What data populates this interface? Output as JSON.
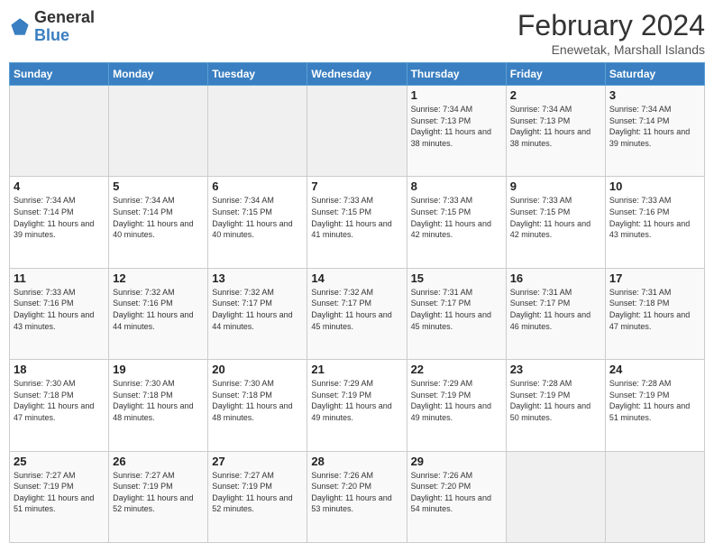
{
  "header": {
    "logo_general": "General",
    "logo_blue": "Blue",
    "month_title": "February 2024",
    "location": "Enewetak, Marshall Islands"
  },
  "days_of_week": [
    "Sunday",
    "Monday",
    "Tuesday",
    "Wednesday",
    "Thursday",
    "Friday",
    "Saturday"
  ],
  "weeks": [
    [
      {
        "day": "",
        "info": ""
      },
      {
        "day": "",
        "info": ""
      },
      {
        "day": "",
        "info": ""
      },
      {
        "day": "",
        "info": ""
      },
      {
        "day": "1",
        "info": "Sunrise: 7:34 AM\nSunset: 7:13 PM\nDaylight: 11 hours\nand 38 minutes."
      },
      {
        "day": "2",
        "info": "Sunrise: 7:34 AM\nSunset: 7:13 PM\nDaylight: 11 hours\nand 38 minutes."
      },
      {
        "day": "3",
        "info": "Sunrise: 7:34 AM\nSunset: 7:14 PM\nDaylight: 11 hours\nand 39 minutes."
      }
    ],
    [
      {
        "day": "4",
        "info": "Sunrise: 7:34 AM\nSunset: 7:14 PM\nDaylight: 11 hours\nand 39 minutes."
      },
      {
        "day": "5",
        "info": "Sunrise: 7:34 AM\nSunset: 7:14 PM\nDaylight: 11 hours\nand 40 minutes."
      },
      {
        "day": "6",
        "info": "Sunrise: 7:34 AM\nSunset: 7:15 PM\nDaylight: 11 hours\nand 40 minutes."
      },
      {
        "day": "7",
        "info": "Sunrise: 7:33 AM\nSunset: 7:15 PM\nDaylight: 11 hours\nand 41 minutes."
      },
      {
        "day": "8",
        "info": "Sunrise: 7:33 AM\nSunset: 7:15 PM\nDaylight: 11 hours\nand 42 minutes."
      },
      {
        "day": "9",
        "info": "Sunrise: 7:33 AM\nSunset: 7:15 PM\nDaylight: 11 hours\nand 42 minutes."
      },
      {
        "day": "10",
        "info": "Sunrise: 7:33 AM\nSunset: 7:16 PM\nDaylight: 11 hours\nand 43 minutes."
      }
    ],
    [
      {
        "day": "11",
        "info": "Sunrise: 7:33 AM\nSunset: 7:16 PM\nDaylight: 11 hours\nand 43 minutes."
      },
      {
        "day": "12",
        "info": "Sunrise: 7:32 AM\nSunset: 7:16 PM\nDaylight: 11 hours\nand 44 minutes."
      },
      {
        "day": "13",
        "info": "Sunrise: 7:32 AM\nSunset: 7:17 PM\nDaylight: 11 hours\nand 44 minutes."
      },
      {
        "day": "14",
        "info": "Sunrise: 7:32 AM\nSunset: 7:17 PM\nDaylight: 11 hours\nand 45 minutes."
      },
      {
        "day": "15",
        "info": "Sunrise: 7:31 AM\nSunset: 7:17 PM\nDaylight: 11 hours\nand 45 minutes."
      },
      {
        "day": "16",
        "info": "Sunrise: 7:31 AM\nSunset: 7:17 PM\nDaylight: 11 hours\nand 46 minutes."
      },
      {
        "day": "17",
        "info": "Sunrise: 7:31 AM\nSunset: 7:18 PM\nDaylight: 11 hours\nand 47 minutes."
      }
    ],
    [
      {
        "day": "18",
        "info": "Sunrise: 7:30 AM\nSunset: 7:18 PM\nDaylight: 11 hours\nand 47 minutes."
      },
      {
        "day": "19",
        "info": "Sunrise: 7:30 AM\nSunset: 7:18 PM\nDaylight: 11 hours\nand 48 minutes."
      },
      {
        "day": "20",
        "info": "Sunrise: 7:30 AM\nSunset: 7:18 PM\nDaylight: 11 hours\nand 48 minutes."
      },
      {
        "day": "21",
        "info": "Sunrise: 7:29 AM\nSunset: 7:19 PM\nDaylight: 11 hours\nand 49 minutes."
      },
      {
        "day": "22",
        "info": "Sunrise: 7:29 AM\nSunset: 7:19 PM\nDaylight: 11 hours\nand 49 minutes."
      },
      {
        "day": "23",
        "info": "Sunrise: 7:28 AM\nSunset: 7:19 PM\nDaylight: 11 hours\nand 50 minutes."
      },
      {
        "day": "24",
        "info": "Sunrise: 7:28 AM\nSunset: 7:19 PM\nDaylight: 11 hours\nand 51 minutes."
      }
    ],
    [
      {
        "day": "25",
        "info": "Sunrise: 7:27 AM\nSunset: 7:19 PM\nDaylight: 11 hours\nand 51 minutes."
      },
      {
        "day": "26",
        "info": "Sunrise: 7:27 AM\nSunset: 7:19 PM\nDaylight: 11 hours\nand 52 minutes."
      },
      {
        "day": "27",
        "info": "Sunrise: 7:27 AM\nSunset: 7:19 PM\nDaylight: 11 hours\nand 52 minutes."
      },
      {
        "day": "28",
        "info": "Sunrise: 7:26 AM\nSunset: 7:20 PM\nDaylight: 11 hours\nand 53 minutes."
      },
      {
        "day": "29",
        "info": "Sunrise: 7:26 AM\nSunset: 7:20 PM\nDaylight: 11 hours\nand 54 minutes."
      },
      {
        "day": "",
        "info": ""
      },
      {
        "day": "",
        "info": ""
      }
    ]
  ]
}
